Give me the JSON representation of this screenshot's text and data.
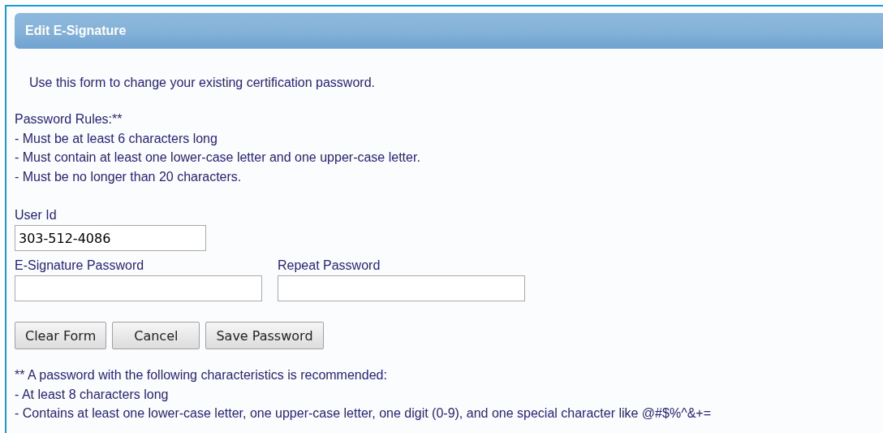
{
  "panel": {
    "title": "Edit E-Signature"
  },
  "intro": "Use this form to change your existing certification password.",
  "rules": {
    "heading": "Password Rules:**",
    "items": [
      "- Must be at least 6 characters long",
      "- Must contain at least one lower-case letter and one upper-case letter.",
      "- Must be no longer than 20 characters."
    ]
  },
  "fields": [
    {
      "label": "User Id",
      "value": "303-512-4086"
    }
  ],
  "password_fields": [
    {
      "label": "E-Signature Password"
    },
    {
      "label": "Repeat Password"
    }
  ],
  "buttons": [
    "Clear Form",
    "Cancel",
    "Save Password"
  ],
  "recommendation": {
    "heading": "** A password with the following characteristics is recommended:",
    "items": [
      "- At least 8 characters long",
      "- Contains at least one lower-case letter, one upper-case letter, one digit (0-9), and one special character like @#$%^&+="
    ]
  }
}
